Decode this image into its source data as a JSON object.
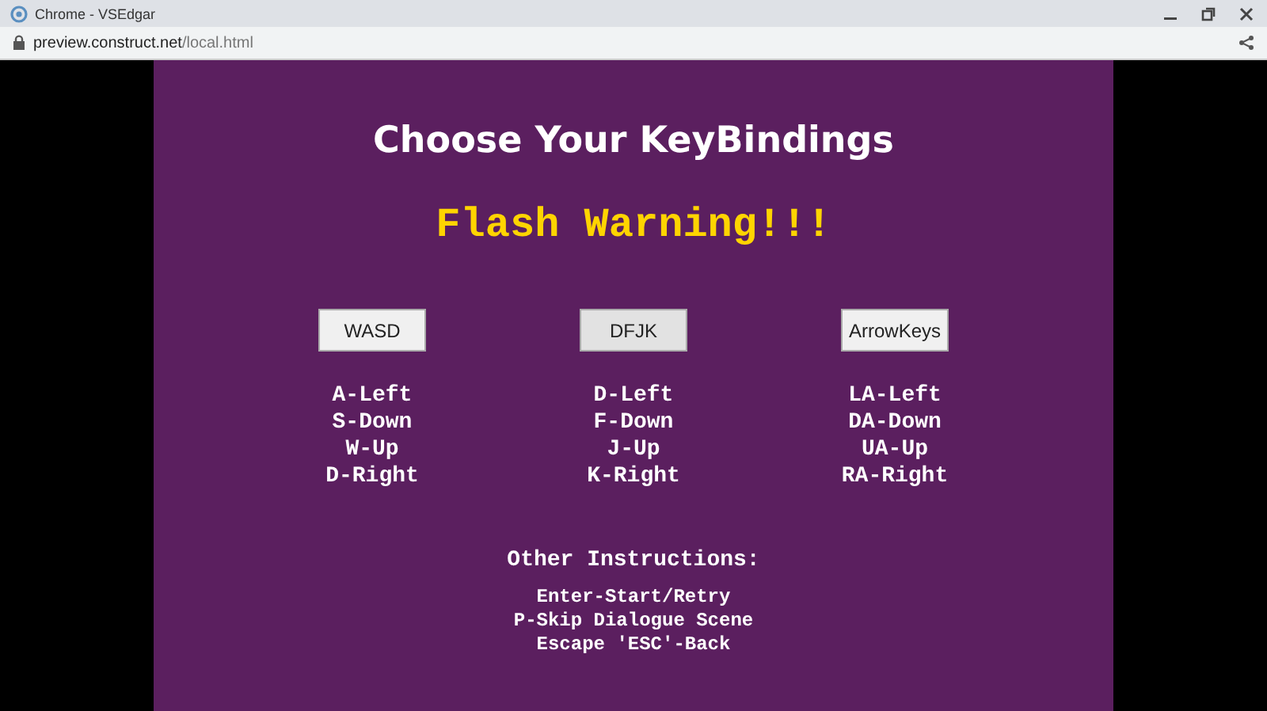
{
  "window": {
    "title": "Chrome - VSEdgar"
  },
  "address_bar": {
    "host": "preview.construct.net",
    "path": "/local.html"
  },
  "game": {
    "title": "Choose Your KeyBindings",
    "warning": "Flash Warning!!!",
    "schemes": [
      {
        "button": "WASD",
        "hovered": false,
        "keys": [
          "A-Left",
          "S-Down",
          "W-Up",
          "D-Right"
        ]
      },
      {
        "button": "DFJK",
        "hovered": true,
        "keys": [
          "D-Left",
          "F-Down",
          "J-Up",
          "K-Right"
        ]
      },
      {
        "button": "ArrowKeys",
        "hovered": false,
        "keys": [
          "LA-Left",
          "DA-Down",
          "UA-Up",
          "RA-Right"
        ]
      }
    ],
    "other_heading": "Other Instructions:",
    "other": [
      "Enter-Start/Retry",
      "P-Skip Dialogue Scene",
      "Escape 'ESC'-Back"
    ]
  }
}
